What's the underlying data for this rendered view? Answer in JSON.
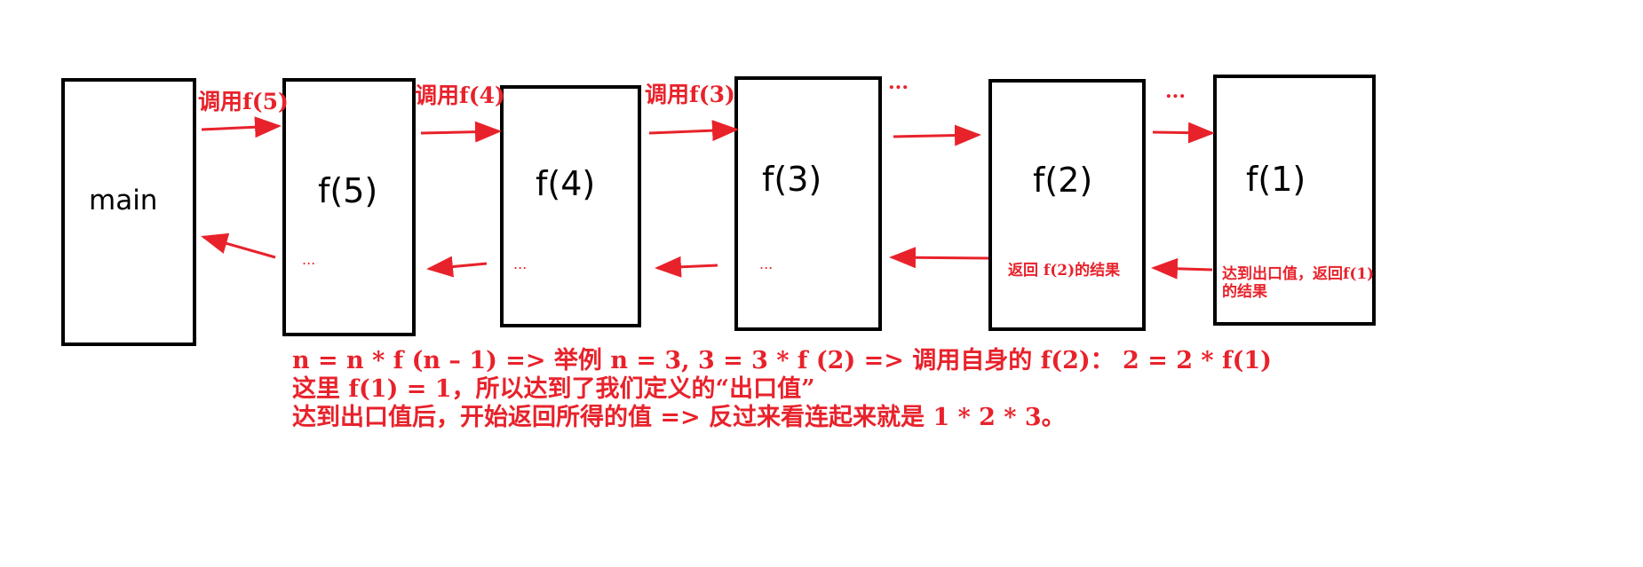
{
  "boxes": {
    "main": "main",
    "f5": "f(5)",
    "f4": "f(4)",
    "f3": "f(3)",
    "f2": "f(2)",
    "f1": "f(1)"
  },
  "calls": {
    "f5": "调用f(5)",
    "f4": "调用f(4)",
    "f3": "调用f(3)",
    "top_dots_1": "...",
    "top_dots_2": "..."
  },
  "returns": {
    "f5_dots": "...",
    "f4_dots": "...",
    "f3_dots": "...",
    "f2_result": "返回 f(2)的结果",
    "f1_line1": "达到出口值，返回f(1)",
    "f1_line2": "的结果"
  },
  "explanation": {
    "line1": "n = n * f (n – 1) => 举例 n = 3, 3 = 3 * f (2) => 调用自身的 f(2)： 2 = 2 * f(1)",
    "line2": "这里 f(1) = 1，所以达到了我们定义的“出口值”",
    "line3": "达到出口值后，开始返回所得的值 => 反过来看连起来就是 1 * 2 * 3。"
  },
  "colors": {
    "accent": "#e8222b",
    "stroke": "#000000"
  }
}
